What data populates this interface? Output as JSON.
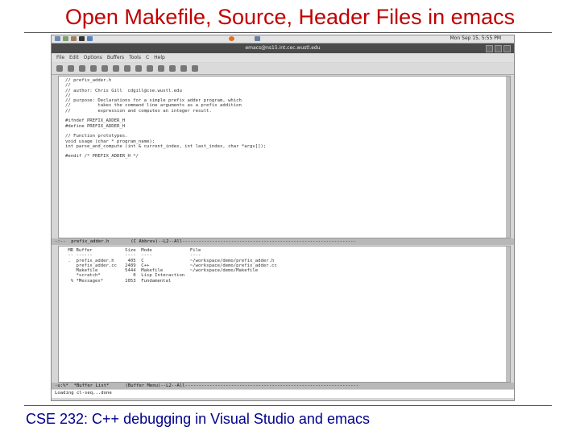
{
  "slide": {
    "title": "Open Makefile, Source, Header Files in emacs",
    "footer": "CSE 232: C++ debugging in Visual Studio and emacs"
  },
  "panel": {
    "clock": "Mon Sep 15,  5:55 PM"
  },
  "window": {
    "title": "emacs@ns15.int.cec.wustl.edu"
  },
  "menu": [
    "File",
    "Edit",
    "Options",
    "Buffers",
    "Tools",
    "C",
    "Help"
  ],
  "editor": {
    "code": "// prefix_adder.h\n//\n// author: Chris Gill  cdgill@cse.wustl.edu\n//\n// purpose: Declarations for a simple prefix adder program, which\n//          takes the command line arguments as a prefix addition\n//          expression and computes an integer result.\n\n#ifndef PREFIX_ADDER_H\n#define PREFIX_ADDER_H\n\n// Function prototypes.\nvoid usage (char * program_name);\nint parse_and_compute (int & current_index, int last_index, char *argv[]);\n\n#endif /* PREFIX_ADDER_H */",
    "modeline": "-:--  prefix_adder.h        (C Abbrev)--L2--All----------------------------------------------------------------"
  },
  "buffer_list": {
    "lines": " MR Buffer            Size  Mode              File\n -- ------            ----  ----              ----\n .  prefix_adder.h     405  C                 ~/workspace/demo/prefix_adder.h\n    prefix_adder.cc   2489  C++               ~/workspace/demo/prefix_adder.cc\n    Makefile          5444  Makefile          ~/workspace/demo/Makefile\n    *scratch*            0  Lisp Interaction\n  % *Messages*        1053  Fundamental",
    "modeline": "-u:%*  *Buffer List*      (Buffer Menu)--L2--All----------------------------------------------------------------"
  },
  "echo": "Loading cl-seq...done"
}
